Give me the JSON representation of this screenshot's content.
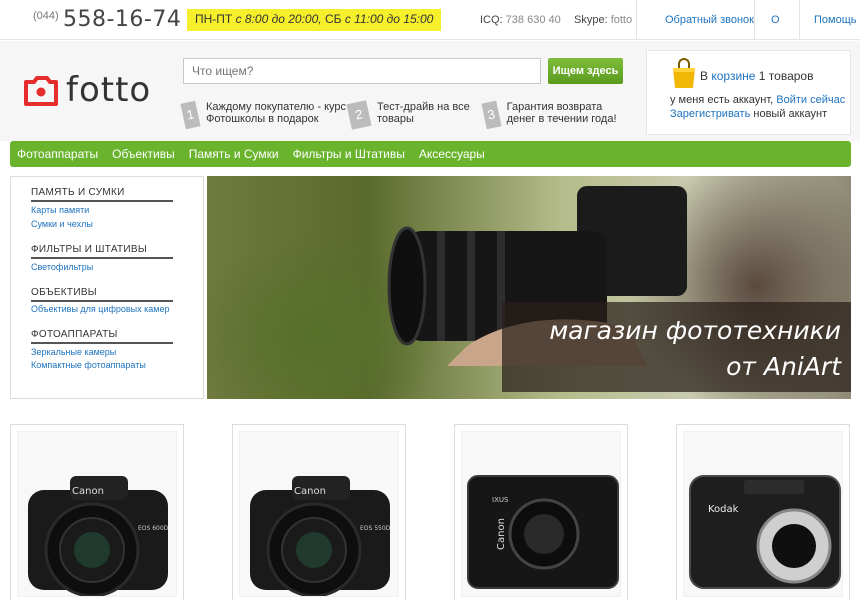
{
  "top": {
    "phone_code": "(044)",
    "phone_number": "558-16-74",
    "hours_days1": "ПН-ПТ",
    "hours_time1": " с 8:00 до 20:00, ",
    "hours_days2": "СБ",
    "hours_time2": " с 11:00 до 15:00",
    "icq_label": "ICQ: ",
    "icq_value": "738 630 40",
    "skype_label": "Skype: ",
    "skype_value": "fotto",
    "links": [
      "Обратный звонок",
      "О нас",
      "Помощь"
    ]
  },
  "logo": {
    "text": "fotto",
    "color": "#e52d2d"
  },
  "search": {
    "placeholder": "Что ищем?",
    "button": "Ищем здесь"
  },
  "promos": [
    {
      "num": "1",
      "text": "Каждому покупателю - курс Фотошколы в подарок"
    },
    {
      "num": "2",
      "text": "Тест-драйв на все товары"
    },
    {
      "num": "3",
      "text": "Гарантия возврата денег в течении года!"
    }
  ],
  "cart": {
    "prefix": "В ",
    "link": "корзине",
    "count": " 1 ",
    "suffix": "товаров",
    "account_text": "у меня есть аккаунт, ",
    "login_link": "Войти сейчас",
    "register_link": "Зарегистривать",
    "register_suffix": " новый аккаунт"
  },
  "nav": [
    "Фотоаппараты",
    "Объективы",
    "Память и Сумки",
    "Фильтры и Штативы",
    "Аксессуары"
  ],
  "sidebar": [
    {
      "title": "ПАМЯТЬ И СУМКИ",
      "links": [
        "Карты памяти",
        "Сумки и чехлы"
      ]
    },
    {
      "title": "ФИЛЬТРЫ И ШТАТИВЫ",
      "links": [
        "Светофильтры"
      ]
    },
    {
      "title": "ОБЪЕКТИВЫ",
      "links": [
        "Объективы для цифровых камер"
      ]
    },
    {
      "title": "ФОТОАППАРАТЫ",
      "links": [
        "Зеркальные камеры",
        "Компактные фотоаппараты"
      ]
    }
  ],
  "banner": {
    "line1": "магазин фототехники",
    "line2": "от AniArt"
  },
  "products": [
    {
      "brand": "Canon",
      "model": "EOS 600D",
      "kind": "dslr"
    },
    {
      "brand": "Canon",
      "model": "EOS 550D",
      "kind": "dslr"
    },
    {
      "brand": "Canon",
      "model": "IXUS",
      "kind": "compact"
    },
    {
      "brand": "Kodak",
      "model": "",
      "kind": "compact-kodak"
    }
  ]
}
